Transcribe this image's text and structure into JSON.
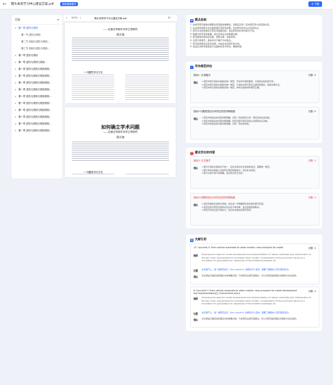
{
  "topbar": {
    "back": "←",
    "title": "撰大本资学习中心建议方案.pdf",
    "badge": "智能搜索模式",
    "export": "⬇ 下载"
  },
  "outline": {
    "title": "目录",
    "collapse": "⇤",
    "items": [
      {
        "label": "第一章 进阶与规则",
        "level": 0,
        "active": true
      },
      {
        "label": "第一节 进阶与规则",
        "level": 1
      },
      {
        "label": "第二节 测验与进阶与规则...",
        "level": 1
      },
      {
        "label": "第三节 测验与进阶与规则...",
        "level": 1
      },
      {
        "label": "第一章 进阶与规则",
        "level": 0
      },
      {
        "label": "第一章 进阶与规则与规则...",
        "level": 0
      },
      {
        "label": "第一章 进阶与规则与规则规则...",
        "level": 0
      },
      {
        "label": "第一章 进阶与规则与规则规则...",
        "level": 0
      },
      {
        "label": "第一章 进阶与规则与规则规则...",
        "level": 0
      },
      {
        "label": "第一章 进阶与规则与规则规则...",
        "level": 0
      },
      {
        "label": "第一章 进阶与规则与规则规则...",
        "level": 0
      },
      {
        "label": "第一章 进阶与规则与规则规则...",
        "level": 0
      },
      {
        "label": "第一章 进阶与规则与规则规则...",
        "level": 0
      },
      {
        "label": "第一章 进阶与规则与规则规则...",
        "level": 0
      },
      {
        "label": "第一章 进阶与规则与规则规则...",
        "level": 0
      },
      {
        "label": "第一章 进阶与规则与规则规则...",
        "level": 0
      }
    ]
  },
  "docbar": {
    "prev": "⟨",
    "zoom": "100%",
    "next": "⟩",
    "filename": "撰大本资学习中心建议方案.pdf",
    "tools": "⊞ ⋯"
  },
  "doc": {
    "page1": {
      "subtitle": "——石家庄市新华中学立项研究",
      "author": "周大海",
      "section": "一 问题意识与方法"
    },
    "page2": {
      "title": "如何确立学术问题",
      "subtitle": "——石家庄市新华中学立项研究",
      "author": "周大海",
      "section": "一 问题意识与方法"
    }
  },
  "summary": {
    "title": "要点总结",
    "items": [
      "1. 在撰写研究报告时需要注意选题的重要性，选题应具有一定的研究意义和实践价值。",
      "2. 在文献综述部分应全面梳理已有研究成果，找出研究的空白点和创新点。",
      "3. 研究方法的选择应与研究问题相匹配，保证研究的科学性和可行性。",
      "4. 数据分析应客观准确，结论应有充分的数据支撑。",
      "5. 研究报告的结构应完整，逻辑清晰，语言规范。",
      "6. 注意引用规范，避免学术不端行为的发生。",
      "7. 研究的局限性应如实说明，并提出未来研究的方向。",
      "8. 最后应对研究报告进行全面的检查与修改，确保质量。"
    ]
  },
  "ai_review": {
    "title": "写作规范评估",
    "cards": [
      {
        "title": "指标1: 引用格式",
        "score": "分数: 5",
        "label": "理由",
        "lines": [
          "1.研究中所引用的文献格式统一规范，符合学术规范要求，引用的文献来源可靠。",
          "2.研究中所引用的文献格式统一规范，引用的文献与研究主题紧密相关，能够支撑论点。",
          "3.研究中所引用的文献格式统一规范，参考文献的排列顺序正确。"
        ]
      },
      {
        "title": "指标2:问题的提出与研究目的的清晰程度",
        "score": "分数: 5",
        "label": "理由",
        "lines": [
          "1.研究中所提出的问题清晰明确，具有一定的研究价值，研究目的表述清楚。",
          "2.研究中所提出的问题清晰明确，研究问题与研究目的之间逻辑关系清晰。",
          "3.研究中所提出的问题清晰明确，具有一定的创新性。"
        ]
      }
    ]
  },
  "issues": {
    "title": "建议优化的内容",
    "cards": [
      {
        "title": "指标3: 引文格式",
        "score": "分数: 3",
        "label": "理由",
        "lines": [
          "1.部分引用的文献格式不统一，存在中英文标点混用的情况，需要统一规范。",
          "2.部分参考文献缺少出版年份或页码等信息，建议补充完整。",
          "3.部分文献引用不够准确，建议核对原文出处。"
        ]
      },
      {
        "title": "指标4:问题的提出与研究目的的清晰程度",
        "score": "分数: 3",
        "label": "理由",
        "lines": [
          "1.研究问题的表述较为笼统，建议进一步明确研究的具体问题与范围。",
          "2.研究目的与研究问题的对应关系不够清晰，建议加强逻辑联系。",
          "3.研究背景的论述不够充分，建议补充相关的研究现状。"
        ]
      }
    ]
  },
  "references": {
    "title": "文献引用",
    "cards": [
      {
        "title": "13. Couclelis H. From cellular automata to urban models: new principles for model",
        "score": "分数: 5",
        "summary_label": "摘要",
        "summary": "Proposes principles for model development and implementation of cellular automata (CA). Examination of the two major requirements for CA-based urban models. Consideration of the prominent nature as a foundation for generalized CA. Awareness of the limitations between all.",
        "loc_label": "位置",
        "loc": "在该章节上，第一章研究设计（Geo-Algebra）的概念与介绍中，需要了解相关介绍与理论知识。",
        "reason_label": "理由",
        "reason": "该文献是元胞自动机理论中的重要文献，与本研究主题高度相关，可以为研究提供理论支撑和方法论指导。"
      },
      {
        "title": "6. Couclelis H. From cellular automata to urban models: new principles for model development and implementation[J]. Environment and p",
        "score": "分数: 5",
        "summary_label": "摘要",
        "summary": "Proposes principles for model development and implementation of cellular automata (CA). Examination of the two major requirements for CA-based urban models. Consideration of the prominent nature as a foundation for generalized CA. Awareness of the limitations between all.",
        "loc_label": "位置",
        "loc": "在该章节上，第一章研究设计（Geo-Algebra）的概念与介绍中，需要了解相关介绍与理论知识。",
        "reason_label": "理由",
        "reason": "该文献是元胞自动机理论中的重要文献，与本研究主题高度相关，可以为研究提供理论支撑和方法论指导。"
      }
    ]
  },
  "colors": {
    "accent": "#2f6bff",
    "danger": "#e03a3a",
    "background": "#eef1f7"
  }
}
